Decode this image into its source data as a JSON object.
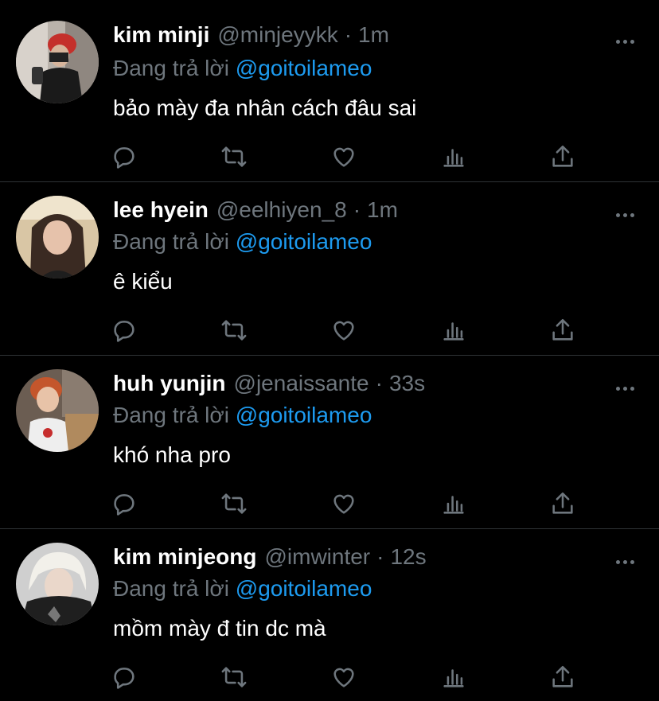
{
  "reply_prefix": "Đang trả lời",
  "tweets": [
    {
      "name": "kim minji",
      "handle": "@minjeyykk",
      "separator": "·",
      "time": "1m",
      "reply_to": "@goitoilameo",
      "text": "bảo mày đa nhân cách đâu sai"
    },
    {
      "name": "lee hyein",
      "handle": "@eelhiyen_8",
      "separator": "·",
      "time": "1m",
      "reply_to": "@goitoilameo",
      "text": "ê kiểu"
    },
    {
      "name": "huh yunjin",
      "handle": "@jenaissante",
      "separator": "·",
      "time": "33s",
      "reply_to": "@goitoilameo",
      "text": "khó nha pro"
    },
    {
      "name": "kim minjeong",
      "handle": "@imwinter",
      "separator": "·",
      "time": "12s",
      "reply_to": "@goitoilameo",
      "text": "mồm mày đ tin dc mà"
    }
  ],
  "colors": {
    "background": "#000000",
    "secondary_text": "#6e767d",
    "mention": "#1d9bf0",
    "divider": "#2f3336"
  },
  "icons": [
    "more-icon",
    "reply-icon",
    "retweet-icon",
    "like-icon",
    "analytics-icon",
    "share-icon"
  ]
}
